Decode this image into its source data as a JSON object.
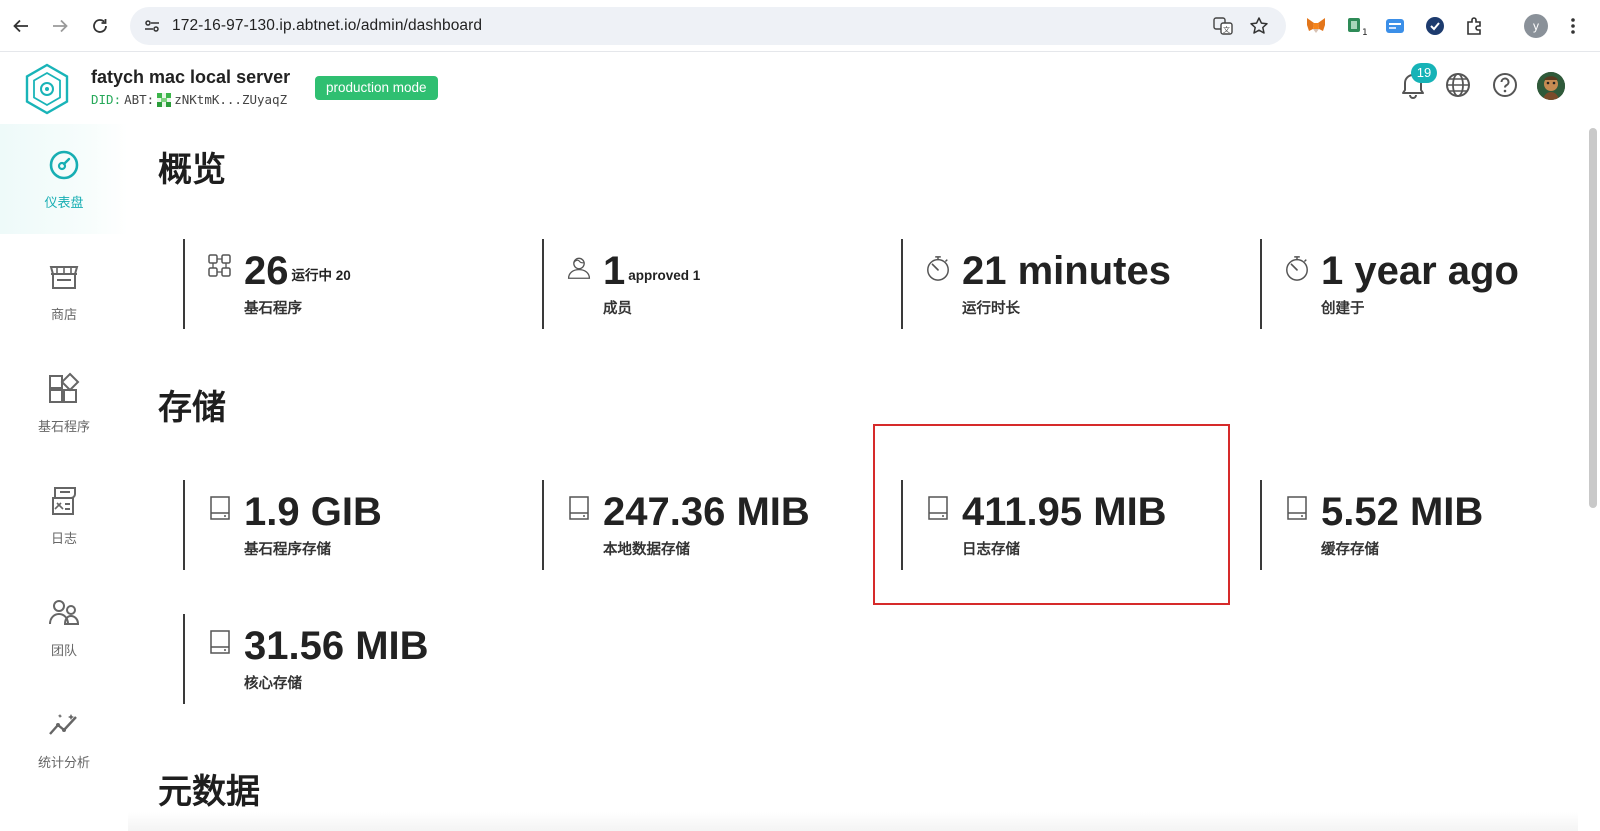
{
  "browser": {
    "url": "172-16-97-130.ip.abtnet.io/admin/dashboard",
    "profile_initial": "y"
  },
  "header": {
    "server_name": "fatych mac local server",
    "did_prefix": "DID:",
    "did_value": "ABT:",
    "did_short": "zNKtmK...ZUyaqZ",
    "mode_badge": "production mode",
    "notification_count": "19"
  },
  "sidebar": {
    "items": [
      {
        "label": "仪表盘",
        "icon": "dashboard-gauge-icon",
        "active": true
      },
      {
        "label": "商店",
        "icon": "store-icon",
        "active": false
      },
      {
        "label": "基石程序",
        "icon": "blocklet-apps-icon",
        "active": false
      },
      {
        "label": "日志",
        "icon": "log-icon",
        "active": false
      },
      {
        "label": "团队",
        "icon": "team-icon",
        "active": false
      },
      {
        "label": "统计分析",
        "icon": "analytics-icon",
        "active": false
      }
    ]
  },
  "overview": {
    "title": "概览",
    "stats": [
      {
        "value": "26",
        "suffix": "运行中 20",
        "label": "基石程序",
        "icon": "apps-grid-icon"
      },
      {
        "value": "1",
        "suffix": "approved 1",
        "label": "成员",
        "icon": "members-icon"
      },
      {
        "value": "21 minutes",
        "suffix": "",
        "label": "运行时长",
        "icon": "stopwatch-icon"
      },
      {
        "value": "1 year ago",
        "suffix": "",
        "label": "创建于",
        "icon": "stopwatch-icon"
      }
    ]
  },
  "storage": {
    "title": "存储",
    "stats": [
      {
        "value": "1.9 GIB",
        "label": "基石程序存储",
        "icon": "drive-icon"
      },
      {
        "value": "247.36 MIB",
        "label": "本地数据存储",
        "icon": "drive-icon"
      },
      {
        "value": "411.95 MIB",
        "label": "日志存储",
        "icon": "drive-icon"
      },
      {
        "value": "5.52 MIB",
        "label": "缓存存储",
        "icon": "drive-icon"
      },
      {
        "value": "31.56 MIB",
        "label": "核心存储",
        "icon": "drive-icon"
      }
    ]
  },
  "metadata": {
    "title": "元数据"
  },
  "colors": {
    "accent": "#16b3b7",
    "badge_green": "#2fbf71",
    "highlight_red": "#d62a2a"
  }
}
